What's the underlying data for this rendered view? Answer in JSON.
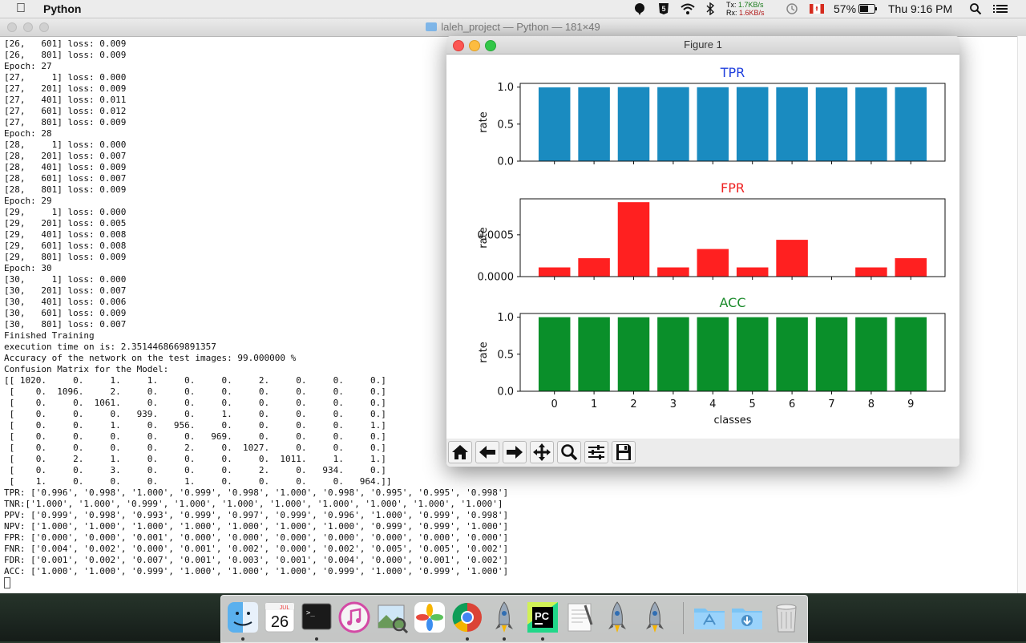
{
  "menubar": {
    "app_name": "Python",
    "net_tx_label": "Tx:",
    "net_tx_value": "1.7KB/s",
    "net_rx_label": "Rx:",
    "net_rx_value": "1.6KB/s",
    "battery": "57%",
    "clock": "Thu 9:16 PM"
  },
  "terminal": {
    "title": "laleh_project — Python — 181×49",
    "lines": [
      "[26,   601] loss: 0.009",
      "[26,   801] loss: 0.009",
      "Epoch: 27",
      "[27,     1] loss: 0.000",
      "[27,   201] loss: 0.009",
      "[27,   401] loss: 0.011",
      "[27,   601] loss: 0.012",
      "[27,   801] loss: 0.009",
      "Epoch: 28",
      "[28,     1] loss: 0.000",
      "[28,   201] loss: 0.007",
      "[28,   401] loss: 0.009",
      "[28,   601] loss: 0.007",
      "[28,   801] loss: 0.009",
      "Epoch: 29",
      "[29,     1] loss: 0.000",
      "[29,   201] loss: 0.005",
      "[29,   401] loss: 0.008",
      "[29,   601] loss: 0.008",
      "[29,   801] loss: 0.009",
      "Epoch: 30",
      "[30,     1] loss: 0.000",
      "[30,   201] loss: 0.007",
      "[30,   401] loss: 0.006",
      "[30,   601] loss: 0.009",
      "[30,   801] loss: 0.007",
      "Finished Training",
      "execution time on is: 2.3514468669891357",
      "Accuracy of the network on the test images: 99.000000 %",
      "Confusion Matrix for the Model:",
      "[[ 1020.     0.     1.     1.     0.     0.     2.     0.     0.     0.]",
      " [    0.  1096.     2.     0.     0.     0.     0.     0.     0.     0.]",
      " [    0.     0.  1061.     0.     0.     0.     0.     0.     0.     0.]",
      " [    0.     0.     0.   939.     0.     1.     0.     0.     0.     0.]",
      " [    0.     0.     1.     0.   956.     0.     0.     0.     0.     1.]",
      " [    0.     0.     0.     0.     0.   969.     0.     0.     0.     0.]",
      " [    0.     0.     0.     0.     2.     0.  1027.     0.     0.     0.]",
      " [    0.     2.     1.     0.     0.     0.     0.  1011.     1.     1.]",
      " [    0.     0.     3.     0.     0.     0.     2.     0.   934.     0.]",
      " [    1.     0.     0.     0.     1.     0.     0.     0.     0.   964.]]",
      "TPR: ['0.996', '0.998', '1.000', '0.999', '0.998', '1.000', '0.998', '0.995', '0.995', '0.998']",
      "TNR:['1.000', '1.000', '0.999', '1.000', '1.000', '1.000', '1.000', '1.000', '1.000', '1.000']",
      "PPV: ['0.999', '0.998', '0.993', '0.999', '0.997', '0.999', '0.996', '1.000', '0.999', '0.998']",
      "NPV: ['1.000', '1.000', '1.000', '1.000', '1.000', '1.000', '1.000', '0.999', '0.999', '1.000']",
      "FPR: ['0.000', '0.000', '0.001', '0.000', '0.000', '0.000', '0.000', '0.000', '0.000', '0.000']",
      "FNR: ['0.004', '0.002', '0.000', '0.001', '0.002', '0.000', '0.002', '0.005', '0.005', '0.002']",
      "FDR: ['0.001', '0.002', '0.007', '0.001', '0.003', '0.001', '0.004', '0.000', '0.001', '0.002']",
      "ACC: ['1.000', '1.000', '0.999', '1.000', '1.000', '1.000', '0.999', '1.000', '0.999', '1.000']"
    ]
  },
  "figure": {
    "title": "Figure 1",
    "toolbar": [
      "home-icon",
      "back-icon",
      "forward-icon",
      "pan-icon",
      "zoom-icon",
      "configure-icon",
      "save-icon"
    ]
  },
  "chart_data": [
    {
      "type": "bar",
      "title": "TPR",
      "ylabel": "rate",
      "xlabel": "",
      "color": "#1a8bc0",
      "title_color": "#1f3fdd",
      "categories": [
        "0",
        "1",
        "2",
        "3",
        "4",
        "5",
        "6",
        "7",
        "8",
        "9"
      ],
      "values": [
        0.996,
        0.998,
        1.0,
        0.999,
        0.998,
        1.0,
        0.998,
        0.995,
        0.995,
        0.998
      ],
      "ylim": [
        0,
        1.05
      ],
      "yticks": [
        "0.0",
        "0.5",
        "1.0"
      ],
      "ytick_values": [
        0,
        0.5,
        1.0
      ],
      "show_xticklabels": false
    },
    {
      "type": "bar",
      "title": "FPR",
      "ylabel": "rate",
      "xlabel": "",
      "color": "#ff2020",
      "title_color": "#ee2222",
      "categories": [
        "0",
        "1",
        "2",
        "3",
        "4",
        "5",
        "6",
        "7",
        "8",
        "9"
      ],
      "values": [
        0.00011,
        0.00022,
        0.00089,
        0.00011,
        0.00033,
        0.00011,
        0.00044,
        0.0,
        0.00011,
        0.00022
      ],
      "ylim": [
        0,
        0.00093
      ],
      "yticks": [
        "0.0000",
        "0.0005"
      ],
      "ytick_values": [
        0,
        0.0005
      ],
      "show_xticklabels": false
    },
    {
      "type": "bar",
      "title": "ACC",
      "ylabel": "rate",
      "xlabel": "classes",
      "color": "#0a8f2a",
      "title_color": "#1a8a2a",
      "categories": [
        "0",
        "1",
        "2",
        "3",
        "4",
        "5",
        "6",
        "7",
        "8",
        "9"
      ],
      "values": [
        1.0,
        1.0,
        0.999,
        1.0,
        1.0,
        1.0,
        0.999,
        1.0,
        0.999,
        1.0
      ],
      "ylim": [
        0,
        1.05
      ],
      "yticks": [
        "0.0",
        "0.5",
        "1.0"
      ],
      "ytick_values": [
        0,
        0.5,
        1.0
      ],
      "show_xticklabels": true
    }
  ],
  "dock": {
    "calendar_month": "JUL",
    "calendar_day": "26",
    "apps": [
      "finder-icon",
      "calendar-icon",
      "terminal-icon",
      "itunes-icon",
      "preview-icon",
      "photos-icon",
      "chrome-icon",
      "python-rocket-icon",
      "pycharm-icon",
      "textedit-icon",
      "python-rocket-icon",
      "python-rocket-icon",
      "applications-folder-icon",
      "downloads-folder-icon",
      "trash-icon"
    ],
    "pycharm_label": "PC"
  }
}
